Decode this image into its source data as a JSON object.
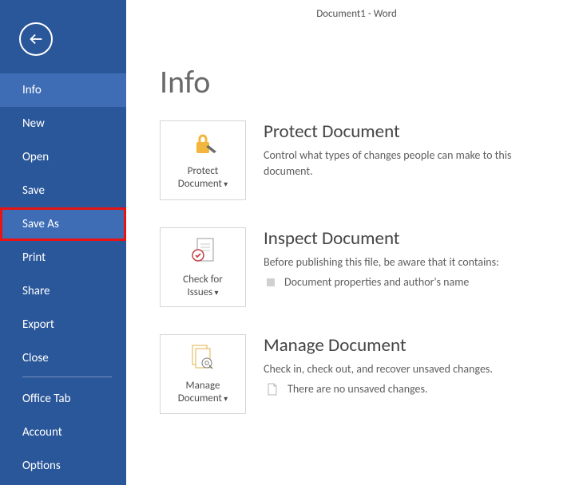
{
  "app_title": "Document1 - Word",
  "page_heading": "Info",
  "sidebar": {
    "items": [
      {
        "label": "Info",
        "active": true,
        "highlight": false
      },
      {
        "label": "New",
        "active": false,
        "highlight": false
      },
      {
        "label": "Open",
        "active": false,
        "highlight": false
      },
      {
        "label": "Save",
        "active": false,
        "highlight": false
      },
      {
        "label": "Save As",
        "active": true,
        "highlight": true
      },
      {
        "label": "Print",
        "active": false,
        "highlight": false
      },
      {
        "label": "Share",
        "active": false,
        "highlight": false
      },
      {
        "label": "Export",
        "active": false,
        "highlight": false
      },
      {
        "label": "Close",
        "active": false,
        "highlight": false
      }
    ],
    "items2": [
      {
        "label": "Office Tab"
      },
      {
        "label": "Account"
      },
      {
        "label": "Options"
      }
    ]
  },
  "sections": {
    "protect": {
      "tile_label_l1": "Protect",
      "tile_label_l2": "Document",
      "title": "Protect Document",
      "desc": "Control what types of changes people can make to this document."
    },
    "inspect": {
      "tile_label_l1": "Check for",
      "tile_label_l2": "Issues",
      "title": "Inspect Document",
      "desc": "Before publishing this file, be aware that it contains:",
      "bullet": "Document properties and author's name"
    },
    "manage": {
      "tile_label_l1": "Manage",
      "tile_label_l2": "Document",
      "title": "Manage Document",
      "desc": "Check in, check out, and recover unsaved changes.",
      "bullet": "There are no unsaved changes."
    }
  }
}
